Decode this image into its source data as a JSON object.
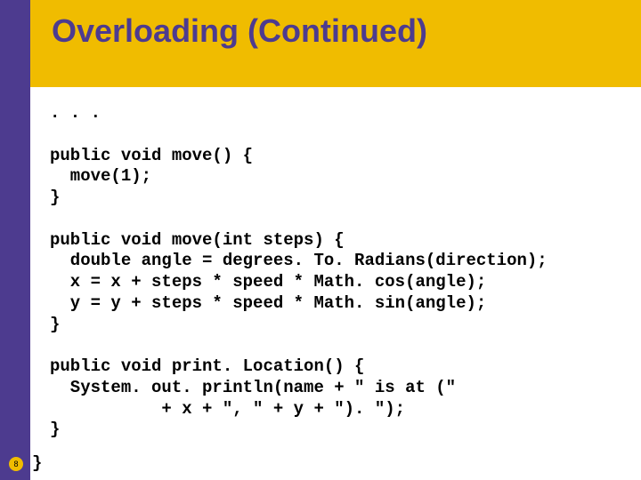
{
  "slide": {
    "title": "Overloading (Continued)",
    "page_number": "8",
    "code": ". . .\n\npublic void move() {\n  move(1);\n}\n\npublic void move(int steps) {\n  double angle = degrees. To. Radians(direction);\n  x = x + steps * speed * Math. cos(angle);\n  y = y + steps * speed * Math. sin(angle);\n}\n\npublic void print. Location() {\n  System. out. println(name + \" is at (\"\n           + x + \", \" + y + \"). \");\n}",
    "closing_brace": "}"
  }
}
